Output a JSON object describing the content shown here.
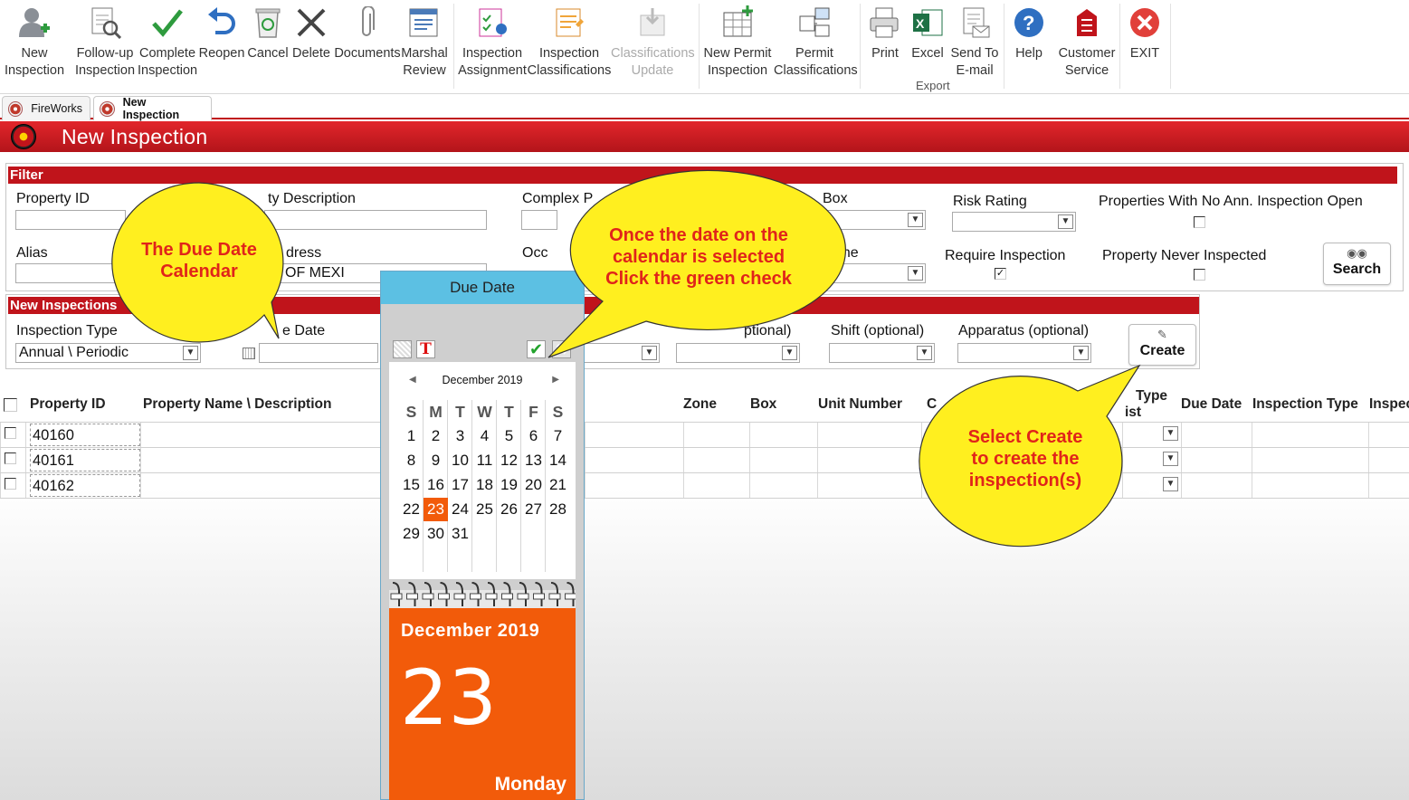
{
  "ribbon": {
    "buttons": [
      {
        "label": "New\nInspection",
        "icon": "add-user-icon"
      },
      {
        "label": "Follow-up\nInspection",
        "icon": "follow-up-icon"
      },
      {
        "label": "Complete\nInspection",
        "icon": "check-icon"
      },
      {
        "label": "Reopen",
        "icon": "undo-arrow-icon"
      },
      {
        "label": "Cancel",
        "icon": "recycle-bin-icon"
      },
      {
        "label": "Delete",
        "icon": "x-icon"
      },
      {
        "label": "Documents",
        "icon": "paperclip-icon"
      },
      {
        "label": "Marshal\nReview",
        "icon": "review-icon"
      },
      {
        "label": "Inspection\nAssignment",
        "icon": "assignment-icon"
      },
      {
        "label": "Inspection\nClassifications",
        "icon": "classifications-icon"
      },
      {
        "label": "Classifications\nUpdate",
        "icon": "download-icon"
      },
      {
        "label": "New Permit\nInspection",
        "icon": "permit-add-icon"
      },
      {
        "label": "Permit\nClassifications",
        "icon": "permit-classifications-icon"
      },
      {
        "label": "Print",
        "icon": "printer-icon"
      },
      {
        "label": "Excel",
        "icon": "excel-icon"
      },
      {
        "label": "Send To\nE-mail",
        "icon": "email-icon"
      },
      {
        "label": "Help",
        "icon": "help-icon"
      },
      {
        "label": "Customer\nService",
        "icon": "customer-service-icon"
      },
      {
        "label": "EXIT",
        "icon": "exit-icon"
      }
    ],
    "export_group": "Export"
  },
  "tabs": [
    {
      "label": "FireWorks"
    },
    {
      "label": "New Inspection"
    }
  ],
  "title": "New Inspection",
  "filter": {
    "header": "Filter",
    "property_id_label": "Property ID",
    "property_id_value": "",
    "property_desc_label": "ty Description",
    "property_desc_value": "",
    "complex_label": "Complex P",
    "complex_value": "",
    "box_label": "Box",
    "box_value": "",
    "risk_label": "Risk Rating",
    "risk_value": "",
    "no_ann_label": "Properties With No Ann. Inspection Open",
    "alias_label": "Alias",
    "alias_value": "",
    "address_label": "dress",
    "address_value": "OF MEXI",
    "occ_label": "Occ",
    "zone_label": "one",
    "zone_value": "",
    "require_label": "Require Inspection",
    "never_label": "Property Never Inspected",
    "search_label": "Search"
  },
  "new_inspections": {
    "header": "New Inspections",
    "type_label": "Inspection Type",
    "type_value": "Annual \\ Periodic",
    "due_label": "e Date",
    "due_value": "",
    "optional_label": "ptional)",
    "shift_label": "Shift (optional)",
    "apparatus_label": "Apparatus (optional)",
    "create_label": "Create"
  },
  "grid": {
    "headers": [
      "Property ID",
      "Property Name \\ Description",
      "Zone",
      "Box",
      "Unit Number",
      "C",
      "Type",
      "ist",
      "Due Date",
      "Inspection Type",
      "Inspec"
    ],
    "rows": [
      {
        "property_id": "40160"
      },
      {
        "property_id": "40161"
      },
      {
        "property_id": "40162"
      }
    ]
  },
  "due_popup": {
    "title": "Due Date",
    "month": "December 2019",
    "weekdays": [
      "S",
      "M",
      "T",
      "W",
      "T",
      "F",
      "S"
    ],
    "weeks": [
      [
        "1",
        "2",
        "3",
        "4",
        "5",
        "6",
        "7"
      ],
      [
        "8",
        "9",
        "10",
        "11",
        "12",
        "13",
        "14"
      ],
      [
        "15",
        "16",
        "17",
        "18",
        "19",
        "20",
        "21"
      ],
      [
        "22",
        "23",
        "24",
        "25",
        "26",
        "27",
        "28"
      ],
      [
        "29",
        "30",
        "31",
        "",
        "",
        "",
        ""
      ]
    ],
    "selected_day": "23",
    "big_month": "December 2019",
    "big_day": "23",
    "big_weekday": "Monday",
    "accent": "#f25b0a"
  },
  "callouts": {
    "due_calendar": "The Due Date\nCalendar",
    "green_check": "Once the date on the\ncalendar is selected\nClick the green check",
    "create": "Select Create\nto create the\ninspection(s)"
  }
}
